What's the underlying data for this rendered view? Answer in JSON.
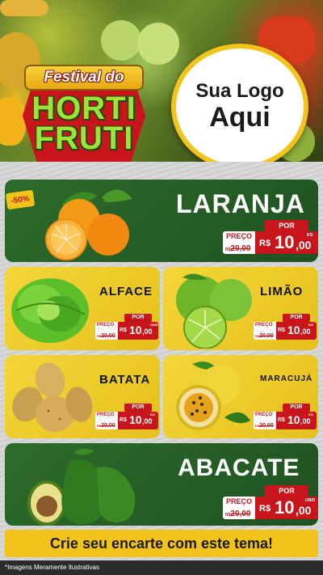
{
  "header": {
    "badge_top": "Festival do",
    "badge_line1": "HORTI",
    "badge_line2": "FRUTI",
    "logo_line1": "Sua Logo",
    "logo_line2": "Aqui"
  },
  "products": [
    {
      "name": "LARANJA",
      "discount": "-50%",
      "por": "POR",
      "preco": "PREÇO",
      "old_prefix": "R$",
      "old": "20,00",
      "currency": "R$",
      "price_int": "10",
      "price_dec": ",00",
      "unit": "KG"
    },
    {
      "name": "ALFACE",
      "por": "POR",
      "preco": "PREÇO",
      "old_prefix": "R$",
      "old": "20,00",
      "currency": "R$",
      "price_int": "10",
      "price_dec": ",00",
      "unit": "UNID"
    },
    {
      "name": "LIMÃO",
      "por": "POR",
      "preco": "PREÇO",
      "old_prefix": "R$",
      "old": "20,00",
      "currency": "R$",
      "price_int": "10",
      "price_dec": ",00",
      "unit": "KG"
    },
    {
      "name": "BATATA",
      "por": "POR",
      "preco": "PREÇO",
      "old_prefix": "R$",
      "old": "20,00",
      "currency": "R$",
      "price_int": "10",
      "price_dec": ",00",
      "unit": "KG"
    },
    {
      "name": "MARACUJÁ",
      "por": "POR",
      "preco": "PREÇO",
      "old_prefix": "R$",
      "old": "20,00",
      "currency": "R$",
      "price_int": "10",
      "price_dec": ",00",
      "unit": "KG"
    },
    {
      "name": "ABACATE",
      "por": "POR",
      "preco": "PREÇO",
      "old_prefix": "R$",
      "old": "20,00",
      "currency": "R$",
      "price_int": "10",
      "price_dec": ",00",
      "unit": "UNID"
    }
  ],
  "cta": "Crie seu encarte com este tema!",
  "footer": "*Imagens Meramente Ilustrativas",
  "colors": {
    "green": "#2e6b2b",
    "yellow": "#f2c41a",
    "red": "#c8141b"
  }
}
